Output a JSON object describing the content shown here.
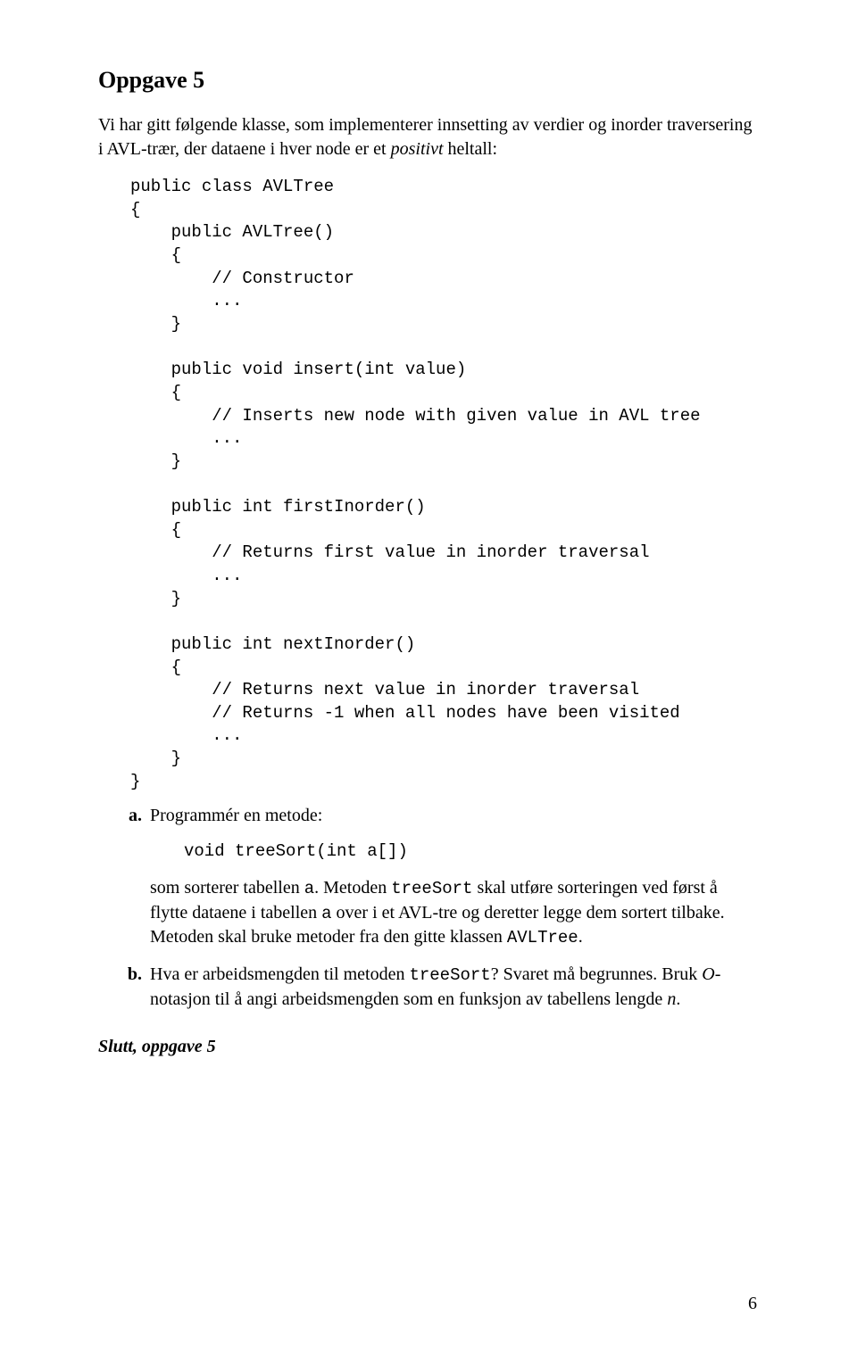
{
  "task_title": "Oppgave 5",
  "intro": {
    "pre": "Vi har gitt følgende klasse, som implementerer innsetting av verdier og inorder traversering i AVL-trær, der dataene i hver node er et ",
    "italic": "positivt",
    "post": " heltall:"
  },
  "code": {
    "l1": "public class AVLTree",
    "l2": "{",
    "l3": "    public AVLTree()",
    "l4": "    {",
    "l5": "        // Constructor",
    "l6": "        ...",
    "l7": "    }",
    "l8": "",
    "l9": "    public void insert(int value)",
    "l10": "    {",
    "l11": "        // Inserts new node with given value in AVL tree",
    "l12": "        ...",
    "l13": "    }",
    "l14": "",
    "l15": "    public int firstInorder()",
    "l16": "    {",
    "l17": "        // Returns first value in inorder traversal",
    "l18": "        ...",
    "l19": "    }",
    "l20": "",
    "l21": "    public int nextInorder()",
    "l22": "    {",
    "l23": "        // Returns next value in inorder traversal",
    "l24": "        // Returns -1 when all nodes have been visited",
    "l25": "        ...",
    "l26": "    }",
    "l27": "}"
  },
  "item_a": {
    "lead": "Programmér en metode:",
    "signature": "void treeSort(int a[])",
    "p1": "som sorterer tabellen ",
    "c1": "a",
    "p2": ". Metoden ",
    "c2": "treeSort",
    "p3": " skal utføre sorteringen ved først å flytte dataene i tabellen ",
    "c3": "a",
    "p4": " over i et AVL-tre og deretter legge dem sortert tilbake. Metoden skal bruke metoder fra den gitte klassen ",
    "c4": "AVLTree",
    "p5": "."
  },
  "item_b": {
    "p1": "Hva er arbeidsmengden til metoden ",
    "c1": "treeSort",
    "p2": "? Svaret må begrunnes. Bruk ",
    "i1": "O",
    "p3": "-notasjon til å angi arbeidsmengden som en funksjon av tabellens lengde ",
    "i2": "n",
    "p4": "."
  },
  "end_line": "Slutt, oppgave 5",
  "page_number": "6"
}
